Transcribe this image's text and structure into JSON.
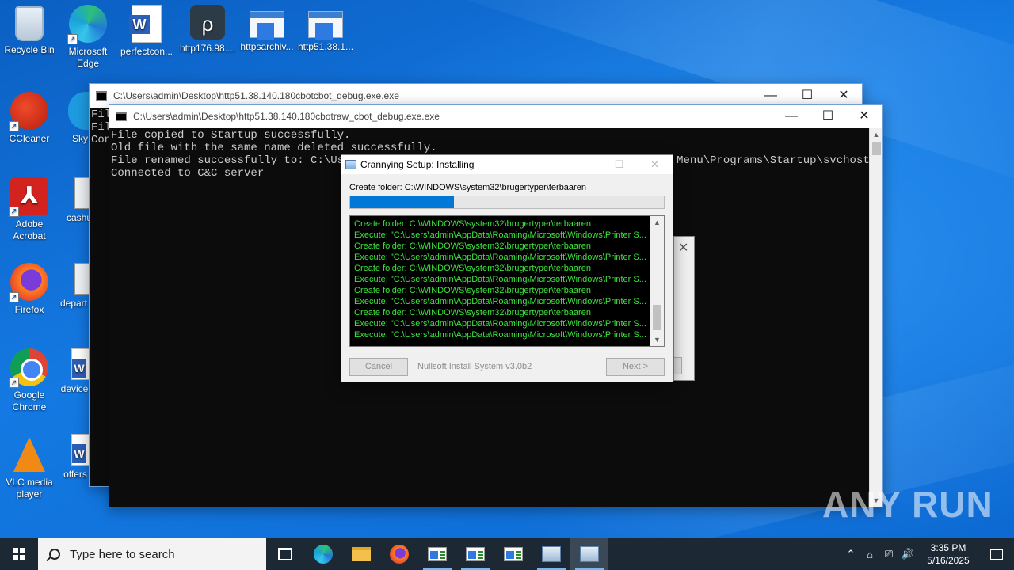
{
  "desktop": {
    "icons": [
      {
        "label": "Recycle Bin",
        "icon": "recycle-bin-icon"
      },
      {
        "label": "Microsoft Edge",
        "icon": "edge-icon"
      },
      {
        "label": "perfectcon...",
        "icon": "word-doc-icon"
      },
      {
        "label": "http176.98....",
        "icon": "git-icon"
      },
      {
        "label": "httpsarchiv...",
        "icon": "window-app-icon"
      },
      {
        "label": "http51.38.1...",
        "icon": "window-app-icon"
      },
      {
        "label": "CCleaner",
        "icon": "ccleaner-icon"
      },
      {
        "label": "Sky",
        "icon": "skype-icon"
      },
      {
        "label": "Adobe Acrobat",
        "icon": "acrobat-icon"
      },
      {
        "label": "cashu",
        "icon": "image-file-icon"
      },
      {
        "label": "Firefox",
        "icon": "firefox-icon"
      },
      {
        "label": "depart",
        "icon": "image-file-icon"
      },
      {
        "label": "Google Chrome",
        "icon": "chrome-icon"
      },
      {
        "label": "device",
        "icon": "word-doc-icon"
      },
      {
        "label": "VLC media player",
        "icon": "vlc-icon"
      },
      {
        "label": "offers",
        "icon": "word-doc-icon"
      }
    ]
  },
  "console_back": {
    "title": "C:\\Users\\admin\\Desktop\\http51.38.140.180cbotcbot_debug.exe.exe",
    "lines": [
      "Fil",
      "Fil",
      "Con"
    ]
  },
  "console_front": {
    "title": "C:\\Users\\admin\\Desktop\\http51.38.140.180cbotraw_cbot_debug.exe.exe",
    "lines": [
      "File copied to Startup successfully.",
      "Old file with the same name deleted successfully.",
      "File renamed successfully to: C:\\Users\\admin\\AppData\\Roaming\\Microsoft\\Windows\\Start Menu\\Programs\\Startup\\svchost.exe",
      "Connected to C&C server"
    ]
  },
  "installer": {
    "title": "Crannying Setup: Installing",
    "status": "Create folder: C:\\WINDOWS\\system32\\brugertyper\\terbaaren",
    "progress": 0.33,
    "log": [
      "Create folder: C:\\WINDOWS\\system32\\brugertyper\\terbaaren",
      "Execute: \"C:\\Users\\admin\\AppData\\Roaming\\Microsoft\\Windows\\Printer S...",
      "Create folder: C:\\WINDOWS\\system32\\brugertyper\\terbaaren",
      "Execute: \"C:\\Users\\admin\\AppData\\Roaming\\Microsoft\\Windows\\Printer S...",
      "Create folder: C:\\WINDOWS\\system32\\brugertyper\\terbaaren",
      "Execute: \"C:\\Users\\admin\\AppData\\Roaming\\Microsoft\\Windows\\Printer S...",
      "Create folder: C:\\WINDOWS\\system32\\brugertyper\\terbaaren",
      "Execute: \"C:\\Users\\admin\\AppData\\Roaming\\Microsoft\\Windows\\Printer S...",
      "Create folder: C:\\WINDOWS\\system32\\brugertyper\\terbaaren",
      "Execute: \"C:\\Users\\admin\\AppData\\Roaming\\Microsoft\\Windows\\Printer S...",
      "Execute: \"C:\\Users\\admin\\AppData\\Roaming\\Microsoft\\Windows\\Printer S..."
    ],
    "cancel_label": "Cancel",
    "brand": "Nullsoft Install System v3.0b2",
    "next_label": "Next >",
    "log_color": "#3ce43c"
  },
  "watermark": "ANY RUN",
  "taskbar": {
    "search_placeholder": "Type here to search",
    "time": "3:35 PM",
    "date": "5/16/2025",
    "accent": "#0078d7"
  },
  "window_controls": {
    "minimize": "—",
    "maximize": "☐",
    "close": "✕"
  }
}
